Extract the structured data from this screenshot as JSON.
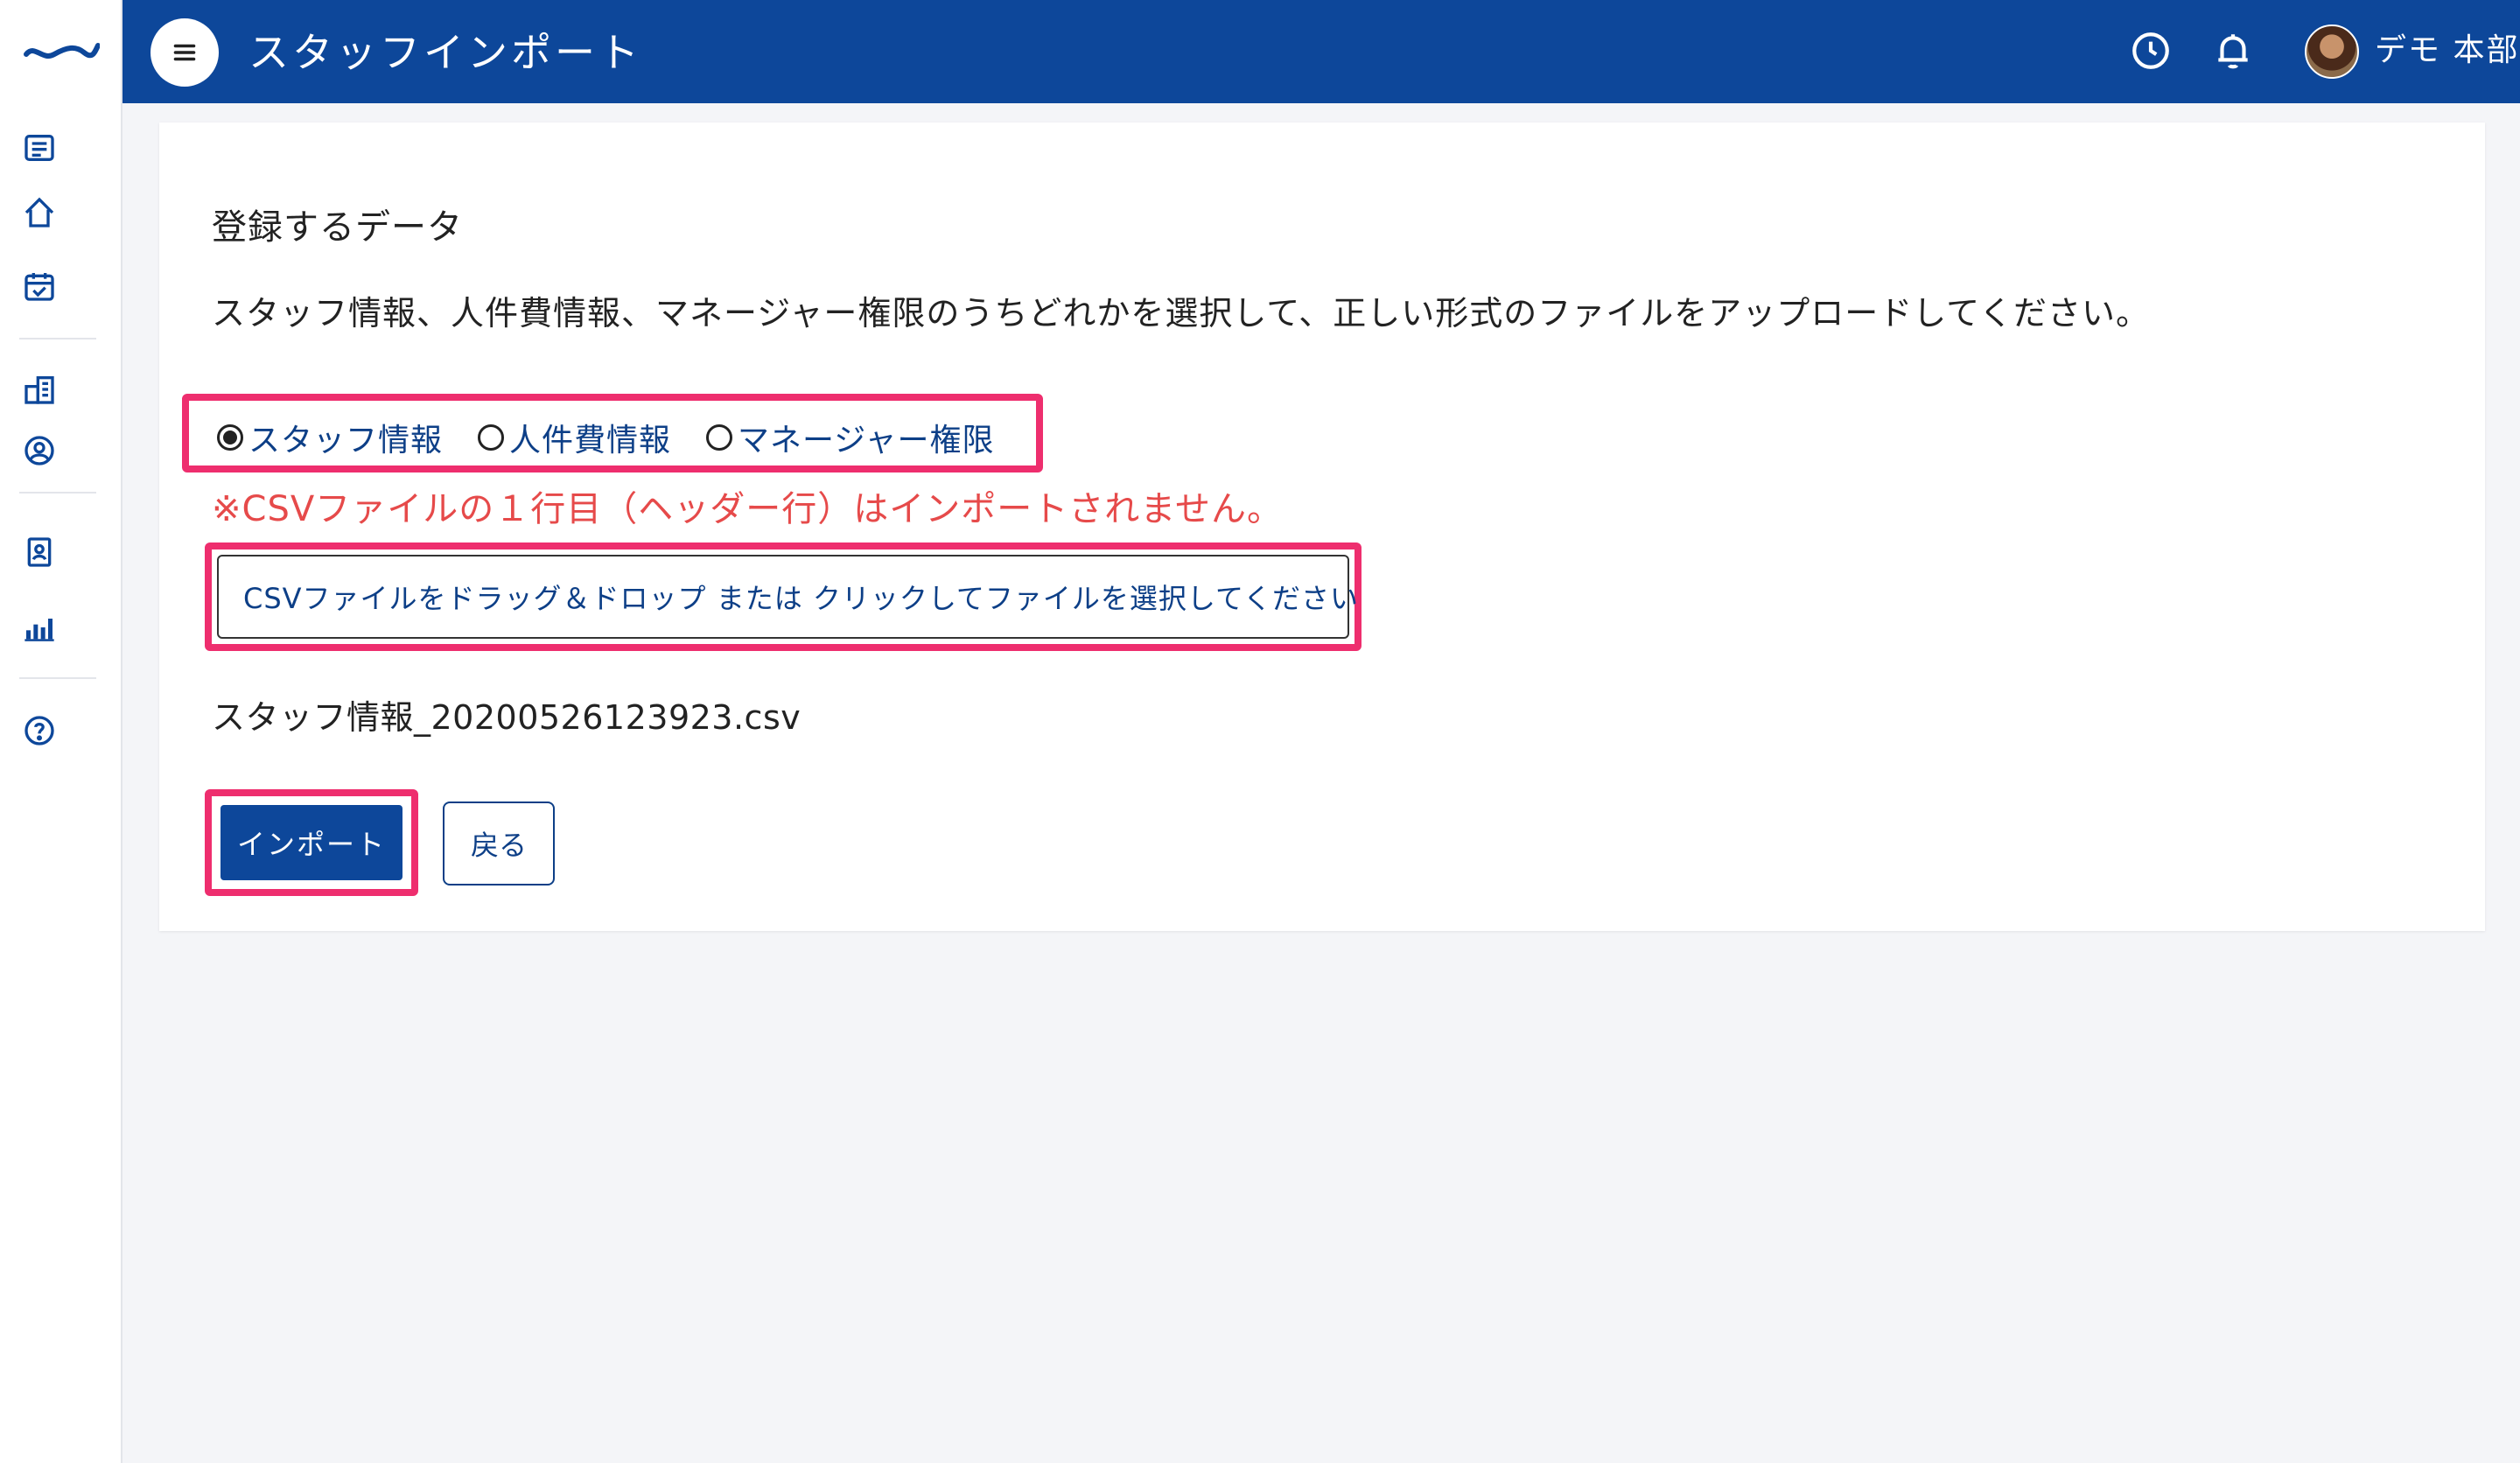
{
  "header": {
    "title": "スタッフインポート",
    "user_name": "デモ 本部"
  },
  "sidebar": {
    "items": [
      {
        "icon": "list-icon"
      },
      {
        "icon": "home-icon"
      },
      {
        "icon": "calendar-check-icon"
      },
      {
        "icon": "building-icon"
      },
      {
        "icon": "user-circle-icon"
      },
      {
        "icon": "id-badge-icon"
      },
      {
        "icon": "bar-chart-icon"
      },
      {
        "icon": "help-icon"
      }
    ]
  },
  "main": {
    "section_title": "登録するデータ",
    "description": "スタッフ情報、人件費情報、マネージャー権限のうちどれかを選択して、正しい形式のファイルをアップロードしてください。",
    "radio_options": [
      {
        "label": "スタッフ情報",
        "checked": true
      },
      {
        "label": "人件費情報",
        "checked": false
      },
      {
        "label": "マネージャー権限",
        "checked": false
      }
    ],
    "warning": "※CSVファイルの１行目（ヘッダー行）はインポートされません。",
    "dropzone_text": "CSVファイルをドラッグ＆ドロップ または クリックしてファイルを選択してください",
    "filename": "スタッフ情報_20200526123923.csv",
    "import_button": "インポート",
    "back_button": "戻る"
  },
  "colors": {
    "primary": "#0d479a",
    "highlight": "#ee2e6e",
    "warning": "#e64a4a",
    "background": "#f4f5f8"
  }
}
